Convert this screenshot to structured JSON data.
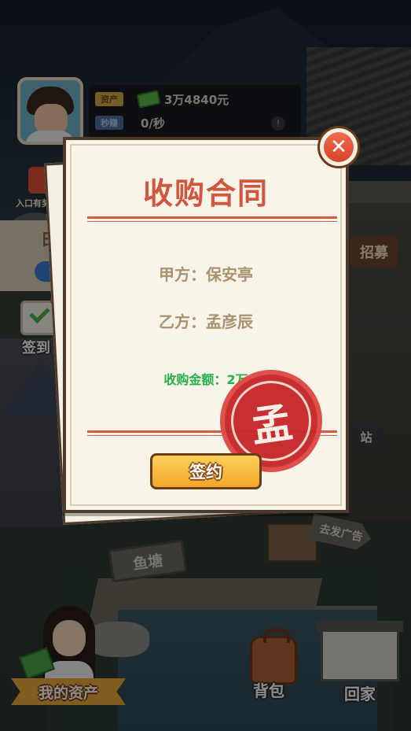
{
  "hud": {
    "assets_tag": "资产",
    "assets_value": "3万4840元",
    "income_tag": "秒赚",
    "income_value": "0/秒",
    "gift_label": "入口有奖",
    "checkin_label": "签到",
    "left_panel_text": "日"
  },
  "scene": {
    "recruit_sign": "招募",
    "station_sign": "站",
    "pond_sign": "鱼塘",
    "ad_sign": "去发广告"
  },
  "contract": {
    "title": "收购合同",
    "party_a": "甲方：保安亭",
    "party_b": "乙方：孟彦辰",
    "amount": "收购金额：2万",
    "seal_char": "孟",
    "sign_button": "签约",
    "close_icon": "close-icon"
  },
  "bottom_nav": {
    "my_assets": "我的资产",
    "backpack": "背包",
    "go_home": "回家"
  },
  "colors": {
    "title_red": "#d2553d",
    "amount_green": "#25b14a",
    "seal_red": "#c7282b",
    "button_orange": "#f4a628"
  }
}
